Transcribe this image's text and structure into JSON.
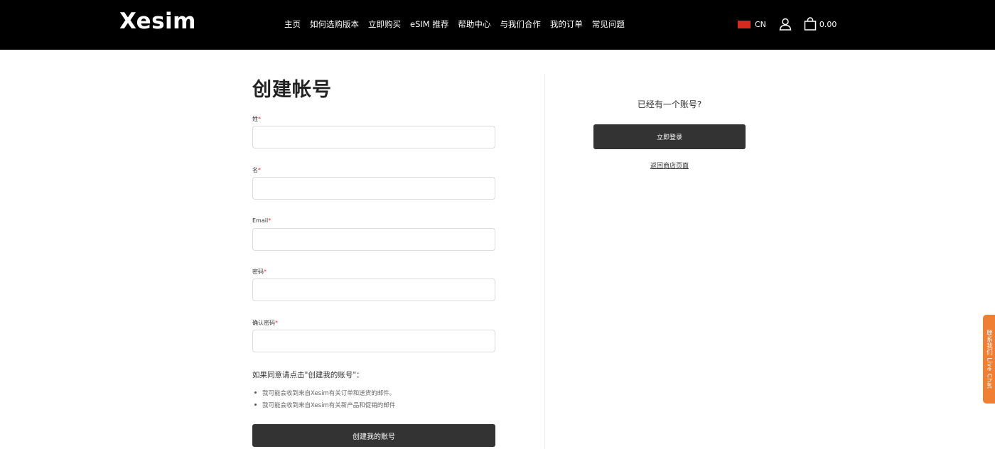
{
  "header": {
    "logo": "Xesim",
    "nav": [
      "主页",
      "如何选购版本",
      "立即购买",
      "eSIM 推荐",
      "帮助中心",
      "与我们合作",
      "我的订单",
      "常见问题"
    ],
    "language": "CN",
    "flag_color": "#d52b1e",
    "cart_amount": "0.00"
  },
  "form": {
    "title": "创建帐号",
    "fields": [
      {
        "label": "姓",
        "value": ""
      },
      {
        "label": "名",
        "value": ""
      },
      {
        "label": "Email",
        "value": ""
      },
      {
        "label": "密码",
        "value": ""
      },
      {
        "label": "确认密码",
        "value": ""
      }
    ],
    "required_mark": "*",
    "consent_text": "如果同意请点击\"创建我的账号\"：",
    "bullets": [
      "我可能会收到来自Xesim有关订单和送货的邮件。",
      "我可能会收到来自Xesim有关新产品和促销的邮件"
    ],
    "submit_label": "创建我的账号"
  },
  "login": {
    "prompt": "已经有一个账号?",
    "button_label": "立即登录",
    "back_link": "返回商店页面"
  },
  "live_chat": {
    "label": "联系我们 Live Chat"
  },
  "colors": {
    "header_bg": "#000000",
    "button_bg": "#333333",
    "chat_bg": "#f07f33",
    "required": "#dd3333"
  }
}
